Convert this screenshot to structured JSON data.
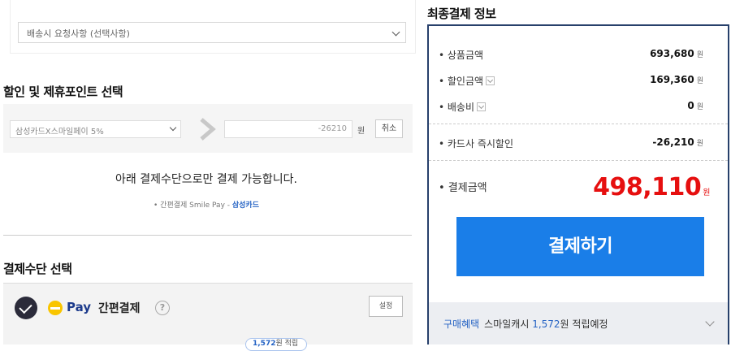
{
  "delivery": {
    "request_placeholder": "배송시 요청사항 (선택사항)"
  },
  "discount": {
    "title": "할인 및 제휴포인트 선택",
    "card_option": "삼성카드X스마일페이 5%",
    "amount": "-26210",
    "won": "원",
    "cancel_label": "취소"
  },
  "notice": {
    "main": "아래 결제수단으로만 결제 가능합니다.",
    "sub_prefix": "• 간편결제 Smile Pay - ",
    "sub_highlight": "삼성카드"
  },
  "payment_method": {
    "title": "결제수단 선택",
    "pay_word": "Pay",
    "pay_easy": "간편결제",
    "help_symbol": "?",
    "setting_label": "설정",
    "reward_value": "1,572",
    "reward_suffix": "원 적립"
  },
  "summary": {
    "title": "최종결제 정보",
    "rows": [
      {
        "label": "• 상품금액",
        "value": "693,680",
        "unit": "원"
      },
      {
        "label": "• 할인금액",
        "value": "169,360",
        "unit": "원"
      },
      {
        "label": "• 배송비",
        "value": "0",
        "unit": "원"
      },
      {
        "label": "• 카드사 즉시할인",
        "value": "-26,210",
        "unit": "원"
      }
    ],
    "total_label": "• 결제금액",
    "total_value": "498,110",
    "total_unit": "원",
    "pay_button": "결제하기",
    "benefit_label": "구매혜택",
    "benefit_text_1": "스마일캐시 ",
    "benefit_amount": "1,572",
    "benefit_text_2": "원 적립예정"
  },
  "colors": {
    "accent_blue": "#1a7ee8",
    "total_red": "#e60f0f",
    "panel_border": "#27406b",
    "pay_yellow": "#f9c500"
  }
}
